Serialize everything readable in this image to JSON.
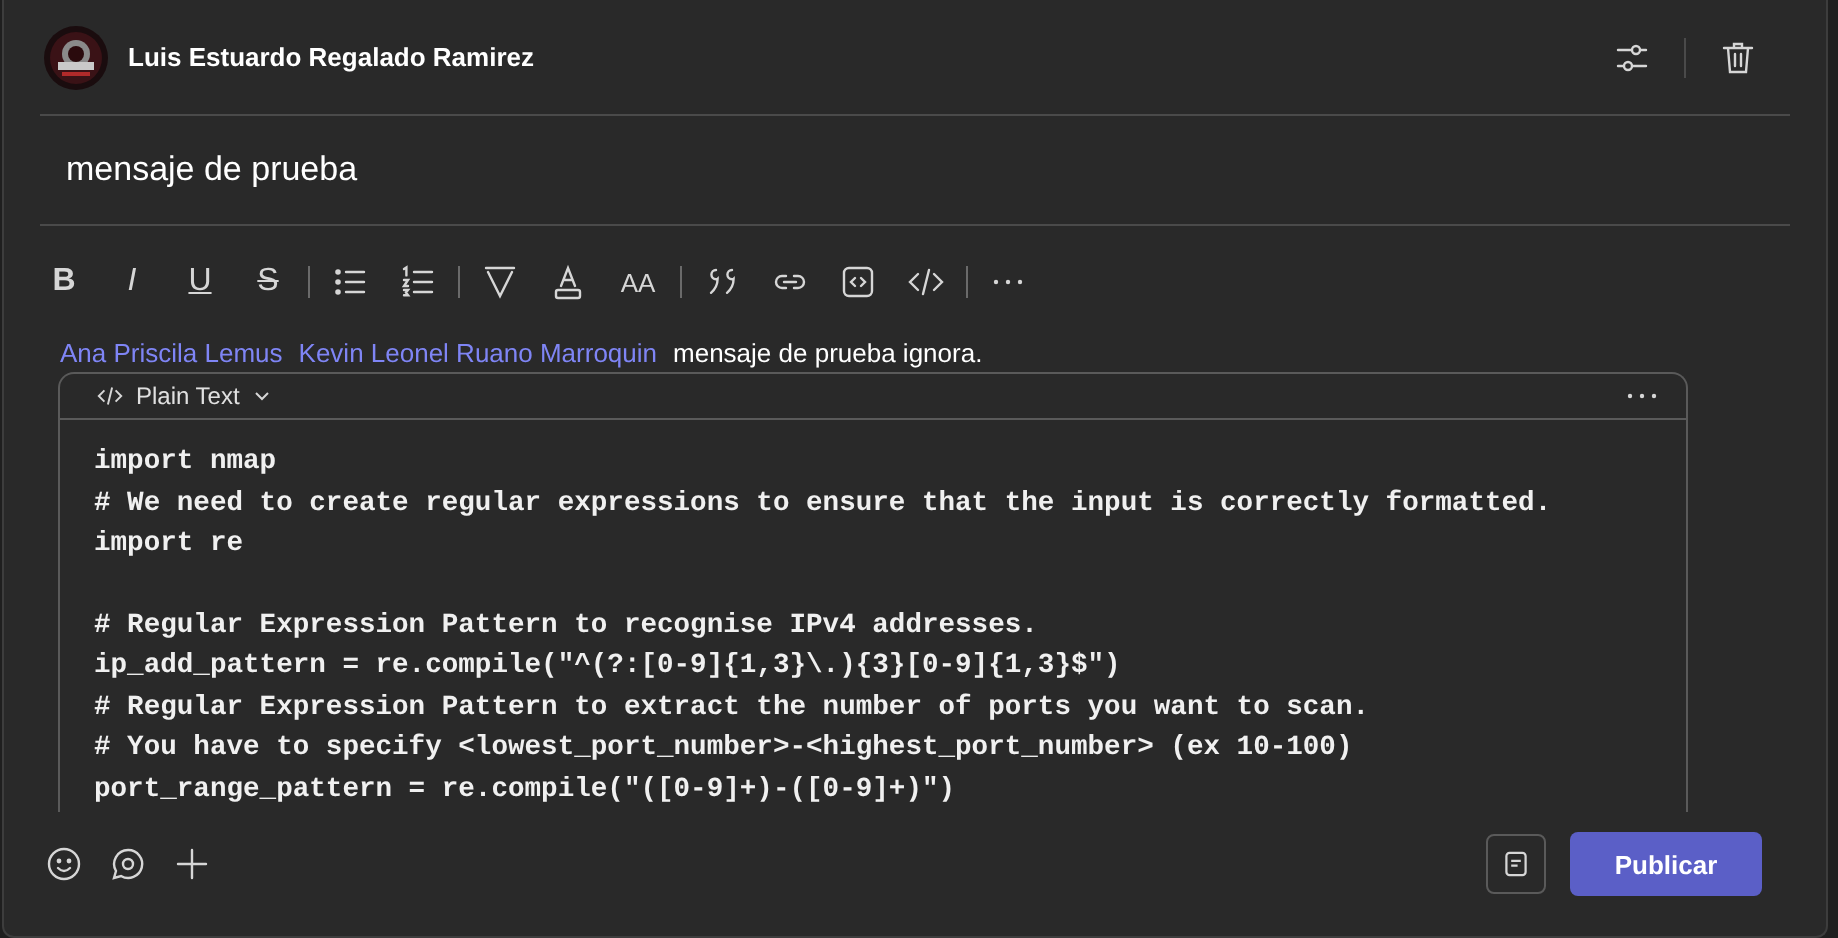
{
  "header": {
    "author": "Luis Estuardo Regalado Ramirez"
  },
  "subject": {
    "value": "mensaje de prueba"
  },
  "toolbar": [
    {
      "kind": "bold",
      "text": "B"
    },
    {
      "kind": "italic",
      "text": "I"
    },
    {
      "kind": "underline",
      "text": "U"
    },
    {
      "kind": "strike",
      "text": "S"
    },
    {
      "kind": "divider"
    },
    {
      "kind": "bullets"
    },
    {
      "kind": "numbered"
    },
    {
      "kind": "divider"
    },
    {
      "kind": "highlight"
    },
    {
      "kind": "font-color"
    },
    {
      "kind": "font-size",
      "text": "AA"
    },
    {
      "kind": "divider"
    },
    {
      "kind": "quote"
    },
    {
      "kind": "link"
    },
    {
      "kind": "snippet"
    },
    {
      "kind": "code"
    },
    {
      "kind": "divider"
    },
    {
      "kind": "more"
    }
  ],
  "message": [
    {
      "kind": "mention",
      "text": "Ana Priscila Lemus"
    },
    {
      "kind": "mention",
      "text": "Kevin Leonel Ruano Marroquin"
    },
    {
      "kind": "text",
      "text": "mensaje de prueba ignora."
    }
  ],
  "code_block": {
    "language": "Plain Text",
    "lines": [
      {
        "kind": "code",
        "text": "import nmap"
      },
      {
        "kind": "code",
        "text": "# We need to create regular expressions to ensure that the input is correctly formatted."
      },
      {
        "kind": "code",
        "text": "import re"
      },
      {
        "kind": "blank"
      },
      {
        "kind": "code",
        "text": "# Regular Expression Pattern to recognise IPv4 addresses."
      },
      {
        "kind": "code",
        "text": "ip_add_pattern = re.compile(\"^(?:[0-9]{1,3}\\.){3}[0-9]{1,3}$\")"
      },
      {
        "kind": "code",
        "text": "# Regular Expression Pattern to extract the number of ports you want to scan."
      },
      {
        "kind": "code",
        "text": "# You have to specify <lowest_port_number>-<highest_port_number> (ex 10-100)"
      },
      {
        "kind": "code",
        "text": "port_range_pattern = re.compile(\"([0-9]+)-([0-9]+)\")"
      }
    ]
  },
  "footer": {
    "post_button": "Publicar"
  }
}
